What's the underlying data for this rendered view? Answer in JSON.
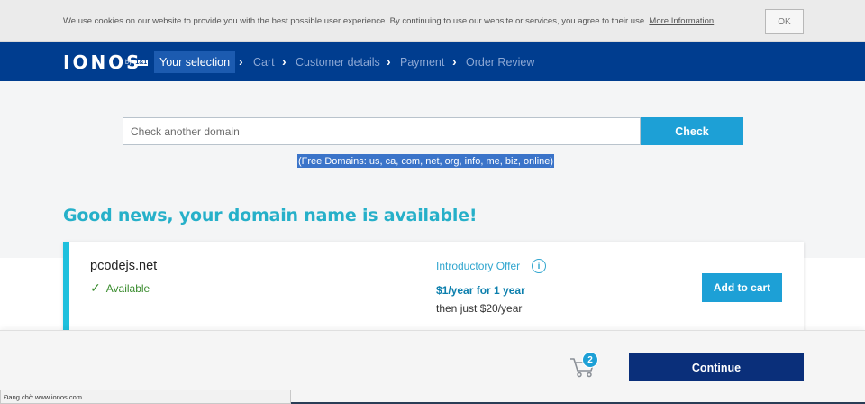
{
  "cookie": {
    "text": "We use cookies on our website to provide you with the best possible user experience. By continuing to use our website or services, you agree to their use.",
    "link": "More Information",
    "ok_label": "OK"
  },
  "nav": {
    "logo": "IONOS",
    "logo_by": "by",
    "logo_brand": "1&1",
    "steps": [
      "Your selection",
      "Cart",
      "Customer details",
      "Payment",
      "Order Review"
    ]
  },
  "search": {
    "placeholder": "Check another domain",
    "button_label": "Check",
    "free_domains": "(Free Domains: us, ca, com, net, org, info, me, biz, online)"
  },
  "result": {
    "headline": "Good news, your domain name is available!",
    "domain": "pcodejs.net",
    "status": "Available",
    "offer_label": "Introductory Offer",
    "info_icon": "i",
    "price": "$1/year for 1 year",
    "renewal": "then just $20/year",
    "add_button": "Add to cart"
  },
  "footer": {
    "cart_count": "2",
    "continue_label": "Continue",
    "browser_status": "Đang chờ www.ionos.com..."
  },
  "colors": {
    "nav_bg": "#003d8f",
    "accent": "#1da0d6",
    "headline": "#26b0c9",
    "continue_bg": "#0a2f7a",
    "available": "#3a8c2e"
  },
  "icons": [
    "chevron-right-icon",
    "info-icon",
    "checkmark-icon",
    "cart-icon"
  ]
}
